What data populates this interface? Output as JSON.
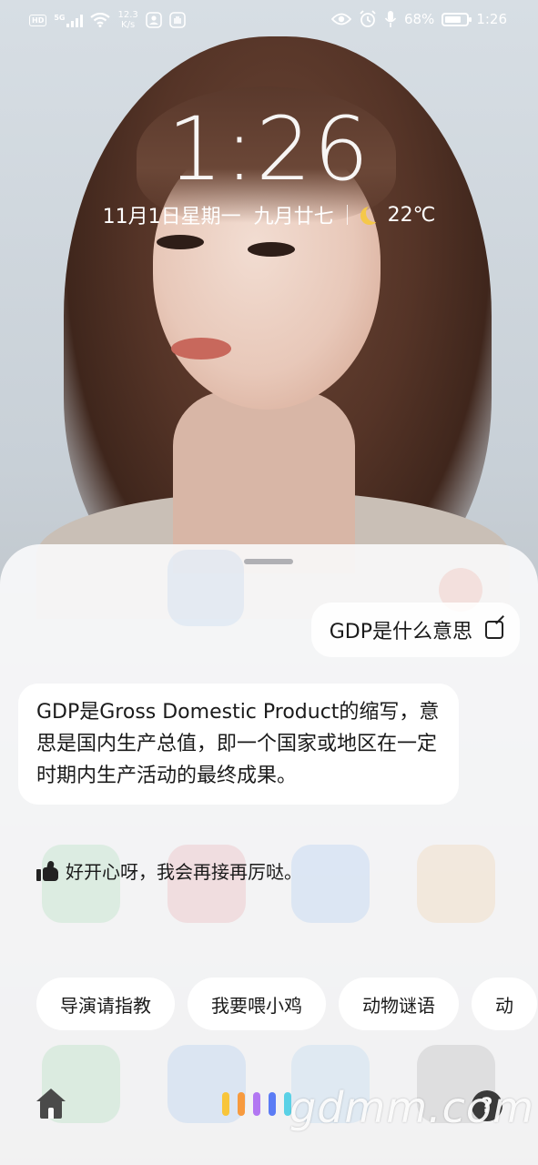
{
  "status_bar": {
    "hd_tag": "HD",
    "network": "5G",
    "speed_top": "12.3",
    "speed_bottom": "K/s",
    "battery": "68%",
    "time": "1:26",
    "battery_level_fraction": 0.68
  },
  "lock_screen": {
    "clock": "1:26",
    "date": "11月1日星期一",
    "lunar_date": "九月廿七",
    "temperature": "22℃"
  },
  "assistant": {
    "user_query": "GDP是什么意思",
    "answer": "GDP是Gross Domestic Product的缩写，意思是国内生产总值，即一个国家或地区在一定时期内生产活动的最终成果。",
    "feedback": "好开心呀，我会再接再厉哒。",
    "suggestions": [
      "导演请指教",
      "我要喂小鸡",
      "动物谜语",
      "动"
    ],
    "voice_colors": [
      "#f8c53a",
      "#f79a3e",
      "#b277f2",
      "#5b7cf5",
      "#5ad1e6"
    ],
    "help_icon": "?"
  },
  "watermark": "gdmm.com"
}
